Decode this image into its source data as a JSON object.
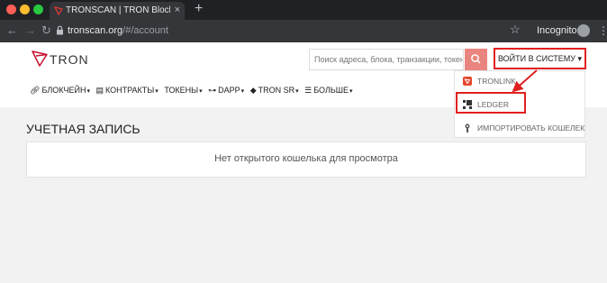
{
  "browser": {
    "tab_title": "TRONSCAN | TRON BlockChain",
    "tab_close": "×",
    "new_tab": "+",
    "url_host": "tronscan.org",
    "url_path": "/#/account",
    "incognito_label": "Incognito"
  },
  "header": {
    "logo_text": "TRON",
    "search_placeholder": "Поиск адреса, блока, транзакции, токена",
    "login_label": "ВОЙТИ В СИСТЕМУ ▾"
  },
  "nav": {
    "items": [
      {
        "label": "БЛОКЧЕЙН",
        "icon": "link-icon"
      },
      {
        "label": "КОНТРАКТЫ",
        "icon": "document-icon"
      },
      {
        "label": "ТОКЕНЫ",
        "icon": "none"
      },
      {
        "label": "DAPP",
        "icon": "gamepad-icon"
      },
      {
        "label": "TRON SR",
        "icon": "shield-icon"
      },
      {
        "label": "БОЛЬШЕ",
        "icon": "list-icon"
      }
    ]
  },
  "login_menu": {
    "items": [
      {
        "label": "TRONLINK",
        "icon": "tronlink-icon"
      },
      {
        "label": "LEDGER",
        "icon": "ledger-icon"
      },
      {
        "label": "ИМПОРТИРОВАТЬ КОШЕЛЕК",
        "icon": "key-icon"
      }
    ]
  },
  "main": {
    "title": "УЧЕТНАЯ ЗАПИСЬ",
    "empty_message": "Нет открытого кошелька для просмотра"
  },
  "colors": {
    "highlight": "#e02020",
    "search_button": "#e9857e",
    "tron_red": "#c8102e"
  }
}
